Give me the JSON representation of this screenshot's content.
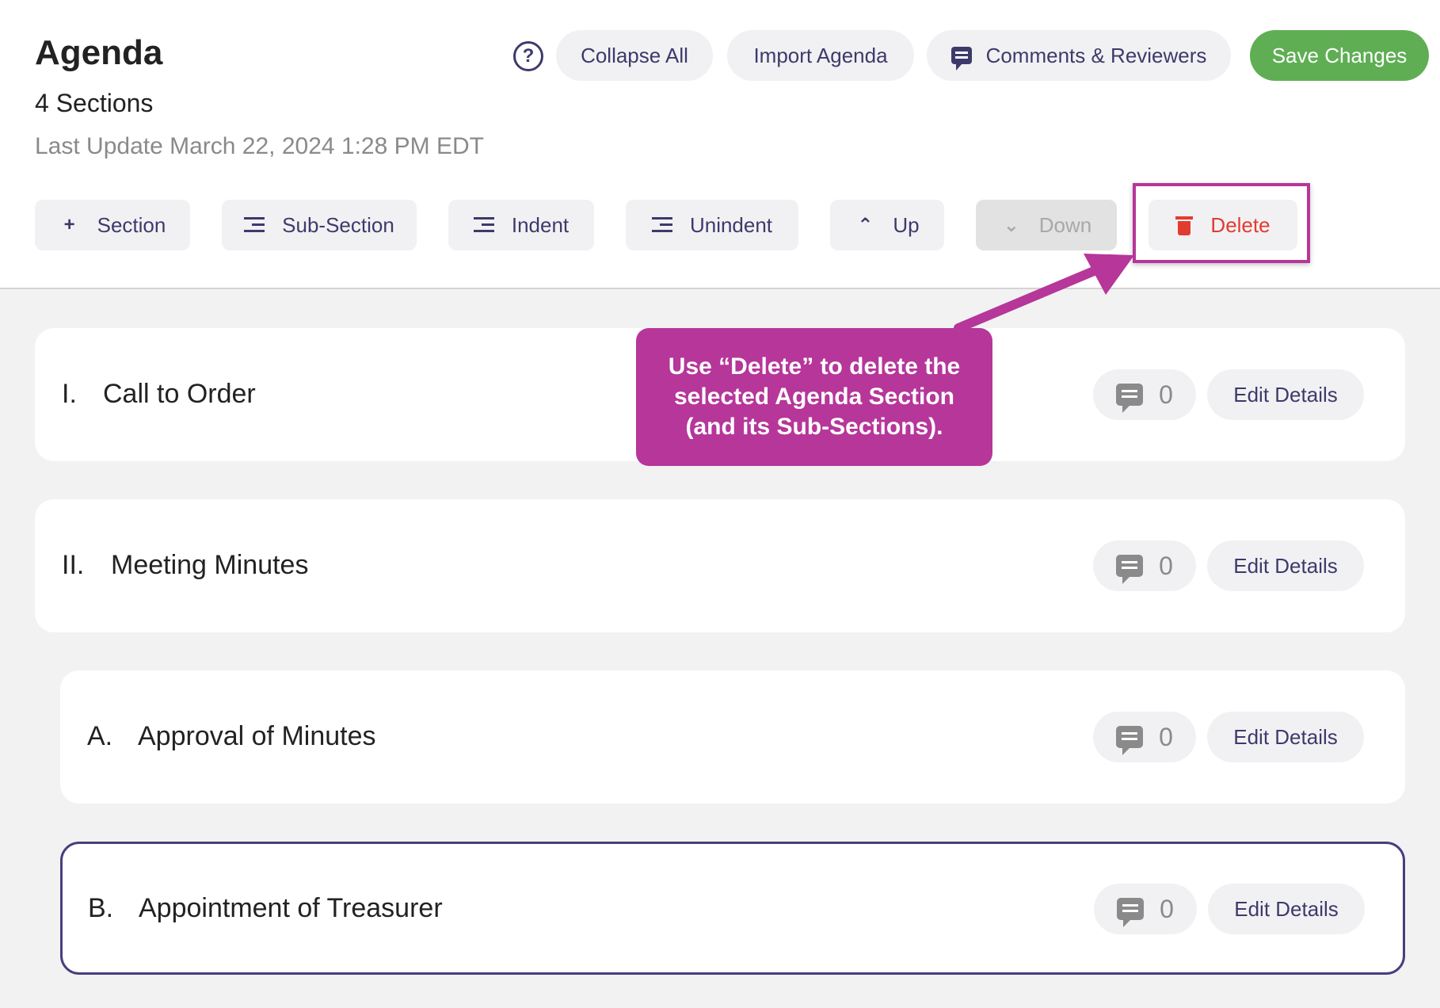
{
  "header": {
    "title": "Agenda",
    "subtitle": "4 Sections",
    "last_update": "Last Update March 22, 2024 1:28 PM EDT",
    "help_glyph": "?",
    "collapse_all": "Collapse All",
    "import_agenda": "Import Agenda",
    "comments_reviewers": "Comments & Reviewers",
    "save_changes": "Save Changes"
  },
  "toolbar": {
    "section": "Section",
    "sub_section": "Sub-Section",
    "indent": "Indent",
    "unindent": "Unindent",
    "up": "Up",
    "down": "Down",
    "delete": "Delete"
  },
  "callout": {
    "text": "Use “Delete” to delete the selected Agenda Section (and its Sub-Sections)."
  },
  "sections": [
    {
      "number": "I.",
      "title": "Call to Order",
      "comments": "0",
      "edit_label": "Edit Details"
    },
    {
      "number": "II.",
      "title": "Meeting Minutes",
      "comments": "0",
      "edit_label": "Edit Details"
    },
    {
      "number": "A.",
      "title": "Approval of Minutes",
      "comments": "0",
      "edit_label": "Edit Details"
    },
    {
      "number": "B.",
      "title": "Appointment of Treasurer",
      "comments": "0",
      "edit_label": "Edit Details"
    }
  ],
  "colors": {
    "accent": "#3d3a6b",
    "save": "#5fae54",
    "danger": "#e23b2f",
    "annotation": "#b6369a",
    "selected_border": "#4a3d7e"
  },
  "icons": [
    "help-icon",
    "comment-icon",
    "plus-icon",
    "sub-section-icon",
    "indent-icon",
    "unindent-icon",
    "chevron-up-icon",
    "chevron-down-icon",
    "trash-icon"
  ]
}
